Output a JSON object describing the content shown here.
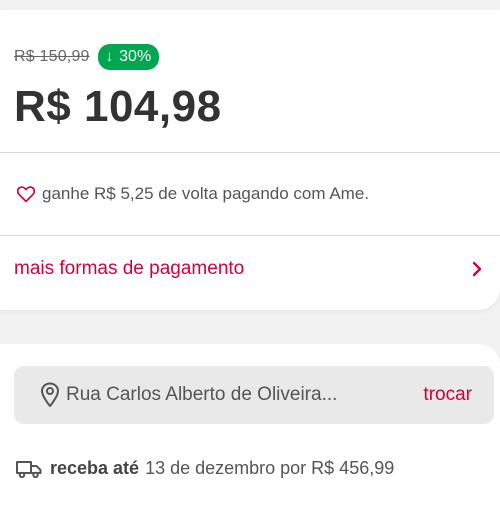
{
  "price": {
    "old_price": "R$ 150,99",
    "discount_arrow": "↓",
    "discount": "30%",
    "current_price": "R$ 104,98"
  },
  "cashback": {
    "icon": "heart-icon",
    "text": "ganhe R$ 5,25 de volta pagando com Ame."
  },
  "payment": {
    "link_label": "mais formas de pagamento",
    "icon": "chevron-right-icon"
  },
  "shipping": {
    "address": "Rua Carlos Alberto de Oliveira...",
    "address_icon": "location-pin-icon",
    "change_label": "trocar",
    "truck_icon": "truck-icon",
    "delivery_prefix": "receba até",
    "delivery_text": "13 de dezembro por R$ 456,99"
  },
  "colors": {
    "accent": "#d1003f",
    "discount_badge": "#00a650",
    "background": "#f2f2f2"
  }
}
